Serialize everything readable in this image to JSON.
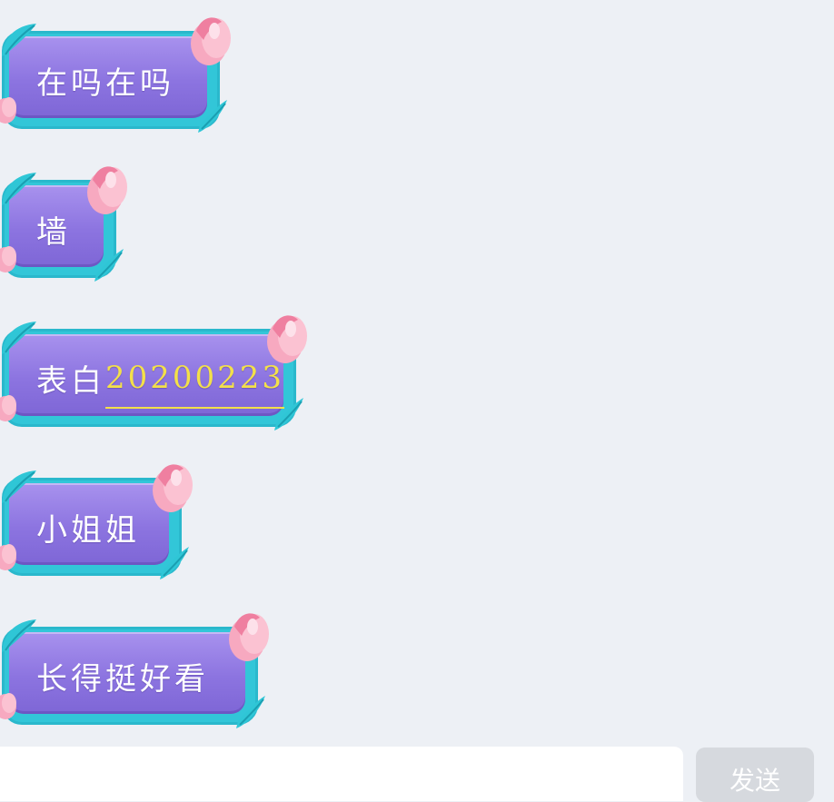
{
  "messages": [
    {
      "text": "在吗在吗"
    },
    {
      "text": "墙"
    },
    {
      "text": "表白",
      "link": "20200223"
    },
    {
      "text": "小姐姐"
    },
    {
      "text": "长得挺好看"
    }
  ],
  "input": {
    "value": "",
    "send_label": "发送"
  },
  "colors": {
    "background": "#edf0f5",
    "bubble_purple": "#8c74e0",
    "bubble_border": "#32c6d8",
    "flower_pink": "#f6a6be",
    "link_yellow": "#f3e04a"
  },
  "icons": [
    "leaf-icon",
    "tulip-icon"
  ]
}
